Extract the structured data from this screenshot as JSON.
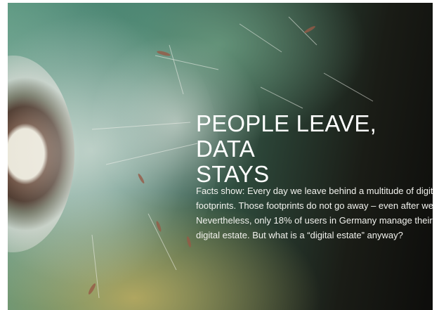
{
  "hero": {
    "headline_line1": "PEOPLE LEAVE, DATA",
    "headline_line2": "STAYS",
    "paragraph_lines": [
      "Facts show: Every day we leave behind a multitude of digital",
      "footprints. Those footprints do not go away – even after we d",
      "Nevertheless, only 18% of users in Germany manage their",
      "digital estate. But what is a “digital estate” anyway?"
    ],
    "background_image": "dandelion-seeds-photo"
  },
  "colors": {
    "headline": "#ffffff",
    "paragraph": "#f2f2ee"
  }
}
